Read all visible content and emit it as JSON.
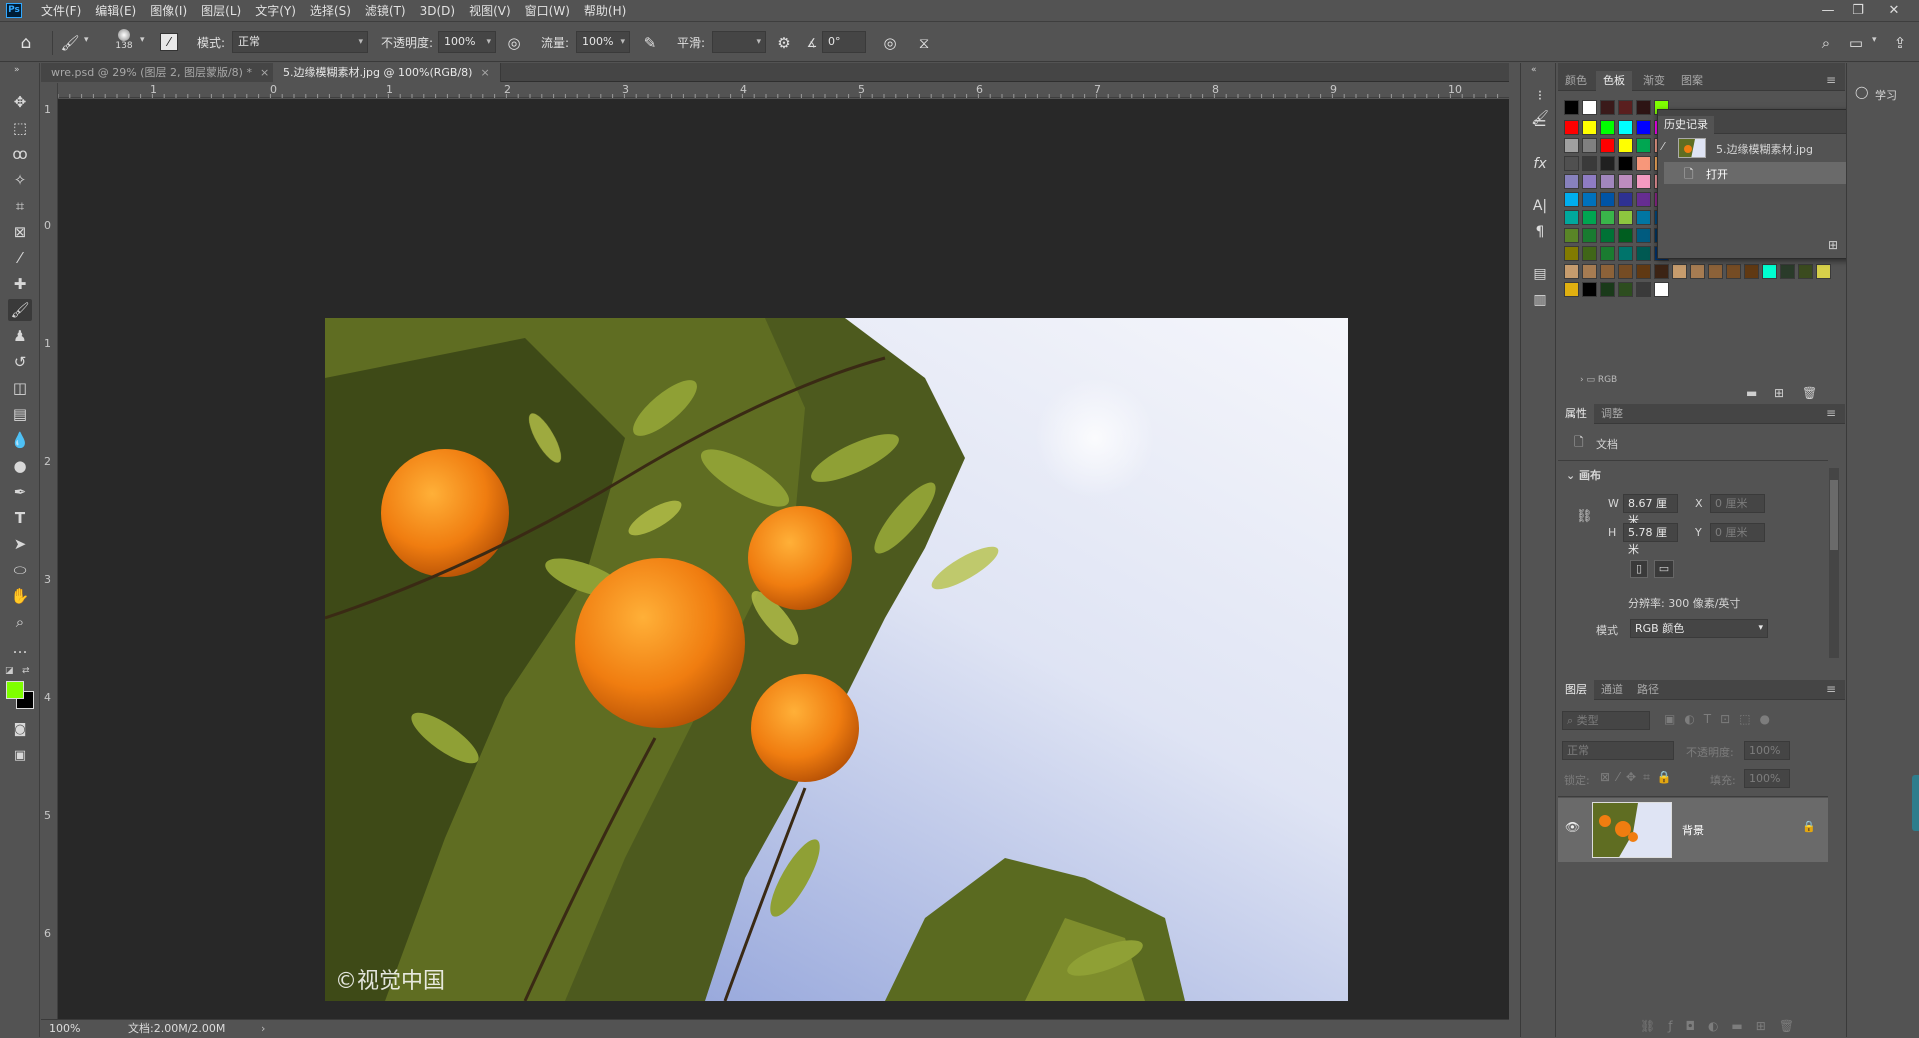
{
  "app": {
    "logo": "Ps"
  },
  "menu": [
    "文件(F)",
    "编辑(E)",
    "图像(I)",
    "图层(L)",
    "文字(Y)",
    "选择(S)",
    "滤镜(T)",
    "3D(D)",
    "视图(V)",
    "窗口(W)",
    "帮助(H)"
  ],
  "window_controls": {
    "minimize": "—",
    "restore": "❐",
    "close": "✕"
  },
  "options": {
    "brush_size": "138",
    "mode_label": "模式:",
    "mode_value": "正常",
    "opacity_label": "不透明度:",
    "opacity_value": "100%",
    "flow_label": "流量:",
    "flow_value": "100%",
    "smooth_label": "平滑:",
    "smooth_value": "",
    "angle_value": "0°"
  },
  "doc_tabs": [
    {
      "title": "wre.psd @ 29% (图层 2, 图层蒙版/8) *",
      "close": "×",
      "active": false
    },
    {
      "title": "5.边缘模糊素材.jpg @ 100%(RGB/8)",
      "close": "×",
      "active": true
    }
  ],
  "ruler_top": [
    "1",
    "0",
    "1",
    "2",
    "3",
    "4",
    "5",
    "6",
    "7",
    "8",
    "9",
    "10"
  ],
  "ruler_left": [
    "1",
    "0",
    "1",
    "2",
    "3",
    "4",
    "5",
    "6"
  ],
  "photo": {
    "watermark": "©视觉中国"
  },
  "status": {
    "zoom": "100%",
    "doc": "文档:2.00M/2.00M",
    "arrow": "›"
  },
  "swatch_panel": {
    "tabs": [
      "颜色",
      "色板",
      "渐变",
      "图案"
    ],
    "active_tab": "色板",
    "folder_label": "RGB",
    "colors_top": [
      "#000000",
      "#ffffff",
      "#3a1a1a",
      "#5a1f1f",
      "#2d1414",
      "#7fff00"
    ],
    "rows": [
      [
        "#ff0000",
        "#ffff00",
        "#00ff00",
        "#00ffff",
        "#0000ff",
        "#ff00ff"
      ],
      [
        "#a0a0a0",
        "#808080",
        "#ff0000",
        "#ffff00",
        "#00a651",
        "#f6a08c"
      ],
      [
        "#505050",
        "#3a3a3a",
        "#202020",
        "#000000",
        "#f7977a",
        "#fbaf5d"
      ],
      [
        "#8781bd",
        "#8e7cc3",
        "#a186be",
        "#bd8cbf",
        "#f49ac1",
        "#f5989d"
      ],
      [
        "#00aeef",
        "#0072bc",
        "#0054a6",
        "#2e3192",
        "#662d91",
        "#92278f"
      ],
      [
        "#00a99d",
        "#00a651",
        "#39b54a",
        "#8dc63f",
        "#0076a3",
        "#004a80"
      ],
      [
        "#598527",
        "#197b30",
        "#007236",
        "#005e20",
        "#005b7f",
        "#003663"
      ],
      [
        "#827b00",
        "#406618",
        "#1a7b30",
        "#00746b",
        "#005952",
        "#003471"
      ],
      [
        "#c69c6d",
        "#a67c52",
        "#8c6239",
        "#754c24",
        "#603913",
        "#3c2415"
      ],
      [
        "#e0b010",
        "#000000",
        "#1a3a1a",
        "#2d4d1f",
        "#3a3a3a",
        "#ffffff"
      ]
    ],
    "extra_row": [
      "#c69c6d",
      "#a67c52",
      "#8c6239",
      "#754c24",
      "#603913",
      "#00ffd0",
      "#2a3b2a",
      "#3b4b1f",
      "#d7d04a"
    ]
  },
  "history_panel": {
    "title": "历史记录",
    "snapshot_label": "5.边缘模糊素材.jpg",
    "step_label": "打开"
  },
  "properties_panel": {
    "tabs": [
      "属性",
      "调整"
    ],
    "doc_label": "文档",
    "section": "画布",
    "w_label": "W",
    "w_value": "8.67 厘米",
    "h_label": "H",
    "h_value": "5.78 厘米",
    "x_label": "X",
    "x_placeholder": "0 厘米",
    "y_label": "Y",
    "y_placeholder": "0 厘米",
    "resolution": "分辨率: 300 像素/英寸",
    "mode_label": "模式",
    "mode_value": "RGB 颜色"
  },
  "layers_panel": {
    "tabs": [
      "图层",
      "通道",
      "路径"
    ],
    "filter_placeholder": "类型",
    "blend_mode": "正常",
    "opacity_label": "不透明度:",
    "opacity_value": "100%",
    "lock_label": "锁定:",
    "fill_label": "填充:",
    "fill_value": "100%",
    "layer_name": "背景"
  },
  "far_right": {
    "learn": "学习"
  }
}
